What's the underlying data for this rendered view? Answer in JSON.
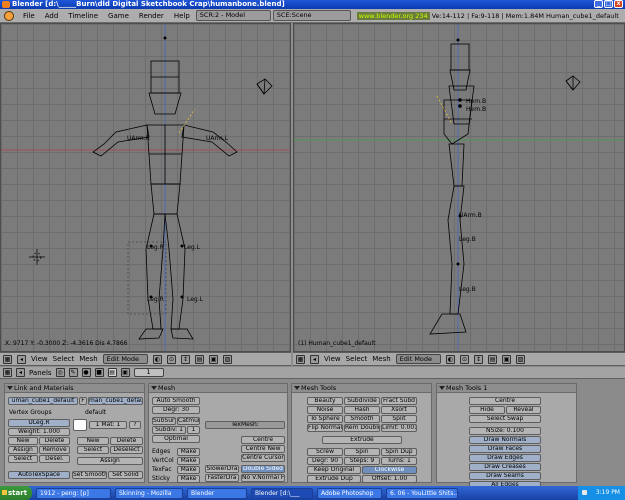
{
  "window": {
    "title": "Blender [d:\\_____Burn\\dld Digital Sketchbook Crap\\humanbone.blend]",
    "btn_min": "_",
    "btn_max": "□",
    "btn_close": "x"
  },
  "menubar": {
    "items": [
      "File",
      "Add",
      "Timeline",
      "Game",
      "Render",
      "Help"
    ],
    "screen_field": "SCR:2 - Model",
    "scene_field": "SCE:Scene",
    "url": "www.blender.org 234",
    "stats": "Ve:14-112 | Fa:9-118 | Mem:1.84M Human_cube1_default"
  },
  "left_view": {
    "coord_readout": "X: 9717  Y: -0.3000  Z: -4.3616  Dis 4.7866",
    "bone_labels": [
      "UArm.R",
      "UArm.L",
      "Leg.R",
      "Leg.L",
      "Leg.R",
      "Leg.L"
    ]
  },
  "right_view": {
    "object_label": "(1) Human_cube1_default",
    "bone_labels": [
      "Hem.B",
      "Hem.B",
      "UArm.B",
      "Leg.B",
      "Leg.B"
    ]
  },
  "view_header": {
    "view": "View",
    "select": "Select",
    "mesh": "Mesh",
    "mode": "Edit Mode"
  },
  "button_header": {
    "panels": "Panels",
    "page": "1"
  },
  "panel_link": {
    "title": "Link and Materials",
    "me_field": "uman_cube1_default",
    "f_label": "F",
    "ob_field": "man_cube1_default",
    "vertex_groups": "Vertex Groups",
    "group_name": "ULeg.R",
    "weight": "Weight: 1.000",
    "new": "New",
    "delete": "Delete",
    "assign": "Assign",
    "remove": "Remove",
    "select": "Select",
    "deselect": "Desel.",
    "default": "default",
    "mat": "1 Mat: 1",
    "question": "?",
    "mat_new": "New",
    "mat_delete": "Delete",
    "mat_select": "Select",
    "mat_deselect": "Deselect",
    "mat_assign": "Assign",
    "auto_tex": "AutoTexSpace",
    "set_smooth": "Set Smooth",
    "set_solid": "Set Solid"
  },
  "panel_mesh": {
    "title": "Mesh",
    "auto_smooth": "Auto Smooth",
    "degr": "Degr: 30",
    "subsurf": "SubSurf",
    "catmul": "Catmul ÷",
    "subdiv": "Subdiv: 1",
    "subdiv_r": "1",
    "optimal": "Optimal",
    "texmesh": "TexMesh:",
    "edges": "Edges",
    "vertcol": "VertCol",
    "texface": "TexFac",
    "sticky": "Sticky",
    "make": "Make",
    "centre": "Centre",
    "centre_new": "Centre New",
    "centre_cursor": "Centre Cursor",
    "slower_draw": "SlowerDra",
    "faster_draw": "FasterDra",
    "double_sided": "Double Sided",
    "no_v_normal": "No V.Normal F"
  },
  "panel_tools": {
    "title": "Mesh Tools",
    "beauty": "Beauty",
    "subdivide": "Subdivide",
    "fract_subd": "Fract Subd",
    "noise": "Noise",
    "hash": "Hash",
    "xsort": "Xsort",
    "to_sphere": "To Sphere",
    "smooth": "Smooth",
    "split": "Split",
    "flip_normal": "Flip Normal",
    "rem_doubles": "Rem Double",
    "limit": "Limit: 0.001",
    "extrude": "Extrude",
    "screw": "Screw",
    "spin": "Spin",
    "spin_dup": "Spin Dup",
    "degr": "Degr: 90",
    "steps": "Steps: 9",
    "turns": "Turns: 1",
    "keep_original": "Keep Original",
    "clockwise": "Clockwise",
    "extrude_dup": "Extrude Dup",
    "offset": "Offset: 1.00"
  },
  "panel_tools1": {
    "title": "Mesh Tools 1",
    "centre": "Centre",
    "hide": "Hide",
    "reveal": "Reveal",
    "select_swap": "Select Swap",
    "nsize": "NSize: 0.100",
    "draw_normals": "Draw Normals",
    "draw_faces": "Draw Faces",
    "draw_edges": "Draw Edges",
    "draw_creases": "Draw Creases",
    "draw_seams": "Draw Seams",
    "all_edges": "All Edges"
  },
  "taskbar": {
    "start": "start",
    "tasks": [
      "1912 - peng: [p]",
      "Skinning - Mozilla",
      "Blender",
      "Blender [d:\\___",
      "Adobe Photoshop",
      "6. 06 - YouLittle Shits..."
    ],
    "time": "3:19 PM"
  },
  "colors": {
    "wire": "#000000",
    "selected_bone": "#e8c23a",
    "grid": "#6d6d6d",
    "viewport_bg": "#7b7b7b",
    "axis_red": "#b04040",
    "axis_green": "#40a040"
  }
}
